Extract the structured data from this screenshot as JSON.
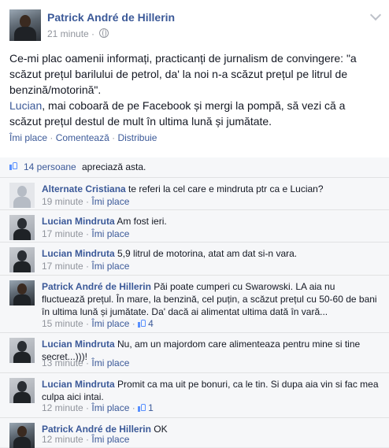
{
  "post": {
    "author": "Patrick André de Hillerin",
    "time": "21 minute",
    "dot": "·",
    "text_line1": "Ce-mi plac oamenii informați, practicanți de jurnalism de convingere: \"a scăzut prețul barilului de petrol, da' la noi n-a scăzut prețul pe litrul de benzină/motorină\".",
    "mention": "Lucian",
    "text_line2": ", mai coboară de pe Facebook și mergi la pompă, să vezi că a scăzut prețul destul de mult în ultima lună și jumătate.",
    "actions": {
      "like": "Îmi place",
      "comment": "Comentează",
      "share": "Distribuie",
      "separator": "·"
    }
  },
  "likes_summary": {
    "count": "14 persoane",
    "rest": "apreciază asta."
  },
  "comments": [
    {
      "author": "Alternate Cristiana",
      "text": "te referi la cel care e mindruta ptr ca e Lucian?",
      "time": "19 minute",
      "like_label": "Îmi place",
      "likes": ""
    },
    {
      "author": "Lucian Mindruta",
      "text": "Am fost ieri.",
      "time": "17 minute",
      "like_label": "Îmi place",
      "likes": ""
    },
    {
      "author": "Lucian Mindruta",
      "text": "5,9 litrul de motorina, atat am dat si-n vara.",
      "time": "17 minute",
      "like_label": "Îmi place",
      "likes": ""
    },
    {
      "author": "Patrick André de Hillerin",
      "text": "Păi poate cumperi cu Swarowski. LA aia nu fluctuează prețul. În mare, la benzină, cel puțin, a scăzut prețul cu 50-60 de bani în ultima lună și jumătate. Da' dacă ai alimentat ultima dată în vară...",
      "time": "15 minute",
      "like_label": "Îmi place",
      "likes": "4"
    },
    {
      "author": "Lucian Mindruta",
      "text": "Nu, am un majordom care alimenteaza pentru mine si tine secret...)))!",
      "time": "13 minute",
      "like_label": "Îmi place",
      "likes": ""
    },
    {
      "author": "Lucian Mindruta",
      "text": "Promit ca ma uit pe bonuri, ca le tin. Si dupa aia vin si fac mea culpa aici intai.",
      "time": "12 minute",
      "like_label": "Îmi place",
      "likes": "1"
    },
    {
      "author": "Patrick André de Hillerin",
      "text": "OK",
      "time": "12 minute",
      "like_label": "Îmi place",
      "likes": ""
    }
  ],
  "colors": {
    "link": "#3b5998",
    "meta": "#90949c",
    "text": "#141823",
    "like_thumb": "#5890ff"
  },
  "icons": {
    "privacy": "globe-icon",
    "options": "chevron-down-icon",
    "like": "thumb-icon"
  }
}
